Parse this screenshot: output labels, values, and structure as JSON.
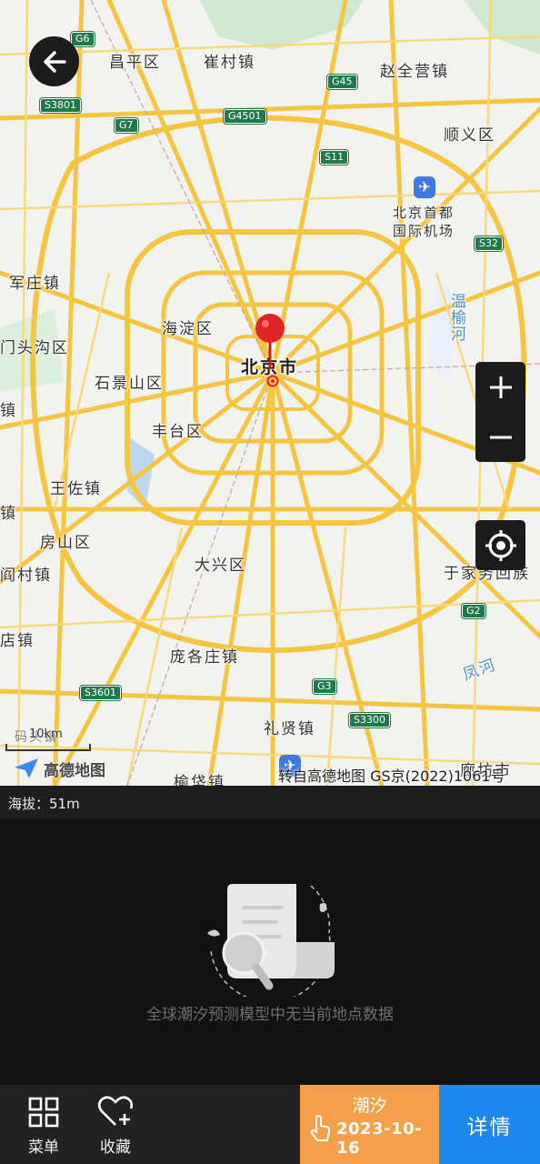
{
  "map": {
    "places": {
      "changping": "昌平区",
      "cuicun": "崔村镇",
      "zhaoquanying": "赵全营镇",
      "shunyi": "顺义区",
      "airport_line1": "北京首都",
      "airport_line2": "国际机场",
      "junzhuang": "军庄镇",
      "haidian": "海淀区",
      "mentougou": "门头沟区",
      "beijing": "北京市",
      "shijingshan": "石景山区",
      "fengtai": "丰台区",
      "wangzuo": "王佐镇",
      "fangshan": "房山区",
      "daxing": "大兴区",
      "yanchun": "阎村镇",
      "yujiawu": "于家务回族",
      "pangezhuang": "庞各庄镇",
      "lixian": "礼贤镇",
      "yufa": "榆垡镇",
      "langfang": "廊坊市",
      "left_zhen1": "镇",
      "left_zhen2": "镇",
      "dianzhen": "店镇",
      "wenyu_river": "温榆河",
      "feng_river": "凤河",
      "zhen_partial": "码头镇"
    },
    "shields": {
      "g6": "G6",
      "g45": "G45",
      "s3801": "S3801",
      "g7": "G7",
      "g4501": "G4501",
      "s11": "S11",
      "s32": "S32",
      "g2": "G2",
      "g3": "G3",
      "s3601": "S3601",
      "s3300": "S3300"
    },
    "scale_label": "10km",
    "logo_text": "高德地图",
    "attribution": "转自高德地图 GS京(2022)1061号"
  },
  "altitude_text": "海拔：51m",
  "empty_message": "全球潮汐预测模型中无当前地点数据",
  "bottom_bar": {
    "menu_label": "菜单",
    "favorite_label": "收藏",
    "tide_label": "潮汐",
    "tide_date": "2023-10-16",
    "detail_label": "详情"
  },
  "colors": {
    "road": "#f5c542",
    "shield": "#1f7a4a",
    "pin": "#e02525",
    "tide_button": "#f7a04b",
    "detail_button": "#1e88f0"
  }
}
